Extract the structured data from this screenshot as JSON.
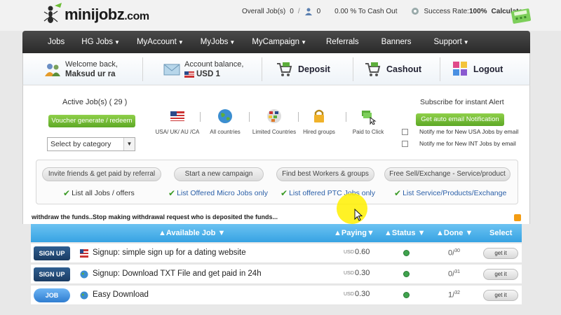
{
  "brand": {
    "name": "minijobz",
    "suffix": ".com"
  },
  "top_stats": {
    "overall_jobs_label": "Overall Job(s)",
    "overall_jobs_value": "0",
    "users_value": "0",
    "cash_out_text": "0.00 % To Cash Out",
    "success_rate_label": "Success Rate:",
    "success_rate_value": "100%",
    "calculator_label": "Calculator"
  },
  "nav": {
    "items": [
      {
        "label": "Jobs",
        "has_menu": false
      },
      {
        "label": "HG Jobs",
        "has_menu": true
      },
      {
        "label": "MyAccount",
        "has_menu": true
      },
      {
        "label": "MyJobs",
        "has_menu": true
      },
      {
        "label": "MyCampaign",
        "has_menu": true
      },
      {
        "label": "Referrals",
        "has_menu": false
      },
      {
        "label": "Banners",
        "has_menu": false
      },
      {
        "label": "Support",
        "has_menu": true
      }
    ]
  },
  "account": {
    "welcome_text": "Welcome back,",
    "user_name": "Maksud ur ra",
    "balance_label": "Account balance,",
    "balance_value": "USD 1",
    "deposit_label": "Deposit",
    "cashout_label": "Cashout",
    "logout_label": "Logout"
  },
  "filters": {
    "active_jobs_text": "Active Job(s) ( 29 )",
    "voucher_label": "Voucher generate / redeem",
    "category_select_value": "Select by category",
    "categories": [
      {
        "label": "USA/ UK/ AU /CA",
        "icon": "usa-flag-icon"
      },
      {
        "label": "All countries",
        "icon": "globe-icon"
      },
      {
        "label": "Limited Countries",
        "icon": "flags-globe-icon"
      },
      {
        "label": "Hired groups",
        "icon": "lock-icon"
      },
      {
        "label": "Paid to Click",
        "icon": "money-click-icon"
      }
    ],
    "subscribe_text": "Subscribe for instant Alert",
    "auto_email_label": "Get auto email Notification",
    "notify_usa": "Notify me for New USA Jobs by email",
    "notify_int": "Notify me for New INT Jobs by email"
  },
  "actions": {
    "pills": [
      "Invite friends & get paid by referral",
      "Start a new campaign",
      "Find best Workers & groups",
      "Free Sell/Exchange - Service/product"
    ],
    "links": [
      "List all Jobs / offers",
      "List Offered Micro Jobs only",
      "List offered PTC Jobs only",
      "List Service/Products/Exchange"
    ]
  },
  "ticker": {
    "text": "withdraw the funds..Stop making withdrawal request who is deposited the funds..."
  },
  "table": {
    "headers": {
      "available_job": "Available Job",
      "paying": "Paying",
      "status": "Status",
      "done": "Done",
      "select": "Select"
    },
    "rows": [
      {
        "badge": "SIGN UP",
        "badge_style": "signup",
        "flag": "usa-flag-icon",
        "title": "Signup: simple sign up for a dating website",
        "currency": "USD",
        "pay": "0.60",
        "done": "0",
        "total": "30",
        "action": "get it"
      },
      {
        "badge": "SIGN UP",
        "badge_style": "signup",
        "flag": "globe-icon",
        "title": "Signup: Download TXT File and get paid in 24h",
        "currency": "USD",
        "pay": "0.30",
        "done": "0",
        "total": "31",
        "action": "get it"
      },
      {
        "badge": "JOB",
        "badge_style": "job",
        "flag": "globe-icon",
        "title": "Easy Download",
        "currency": "USD",
        "pay": "0.30",
        "done": "1",
        "total": "32",
        "action": "get it"
      }
    ]
  },
  "colors": {
    "nav_bg": "#333333",
    "table_header": "#4fb3ea",
    "green_button": "#6cbd35",
    "link_blue": "#2a5fa8",
    "cursor_highlight": "#fff000"
  }
}
